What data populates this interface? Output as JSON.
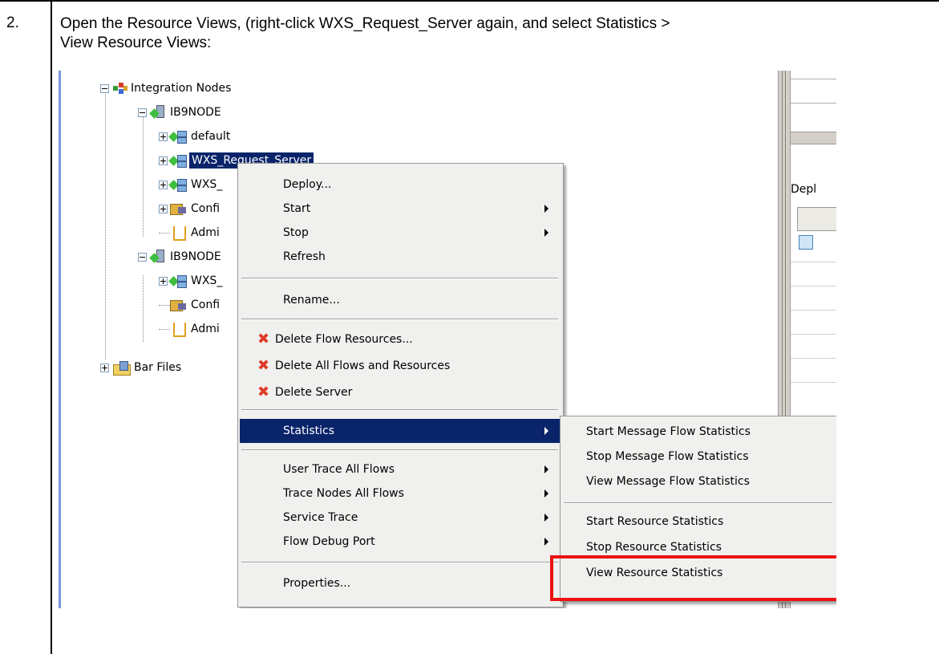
{
  "step": {
    "number": "2.",
    "instruction_line1": "Open the Resource Views, (right-click  WXS_Request_Server again, and select Statistics >",
    "instruction_line2": "View Resource Views:"
  },
  "tree": {
    "root": "Integration Nodes",
    "node1": "IB9NODE",
    "node1_children": [
      "default",
      "WXS_Request_Server",
      "WXS_",
      "Confi",
      "Admi"
    ],
    "node2": "IB9NODE",
    "node2_children": [
      "WXS_",
      "Confi",
      "Admi"
    ],
    "bar_files": "Bar Files"
  },
  "side_panel": {
    "label_fragment": "Depl"
  },
  "context_menu": {
    "items": [
      {
        "label": "Deploy...",
        "submenu": false
      },
      {
        "label": "Start",
        "submenu": true
      },
      {
        "label": "Stop",
        "submenu": true
      },
      {
        "label": "Refresh",
        "submenu": false
      },
      {
        "label": "Rename...",
        "submenu": false
      },
      {
        "label": "Delete Flow Resources...",
        "icon": "red-x-icon"
      },
      {
        "label": "Delete All Flows and Resources",
        "icon": "red-x-icon"
      },
      {
        "label": "Delete Server",
        "icon": "red-x-icon"
      },
      {
        "label": "Statistics",
        "submenu": true,
        "selected": true
      },
      {
        "label": "User Trace All Flows",
        "submenu": true
      },
      {
        "label": "Trace Nodes All Flows",
        "submenu": true
      },
      {
        "label": "Service Trace",
        "submenu": true
      },
      {
        "label": "Flow Debug Port",
        "submenu": true
      },
      {
        "label": "Properties...",
        "submenu": false
      }
    ]
  },
  "statistics_submenu": {
    "items": [
      "Start Message Flow Statistics",
      "Stop Message Flow Statistics",
      "View Message Flow Statistics",
      "Start Resource Statistics",
      "Stop Resource Statistics",
      "View Resource Statistics"
    ],
    "highlighted": "View Resource Statistics"
  },
  "colors": {
    "selection": "#0a246a",
    "menu_bg": "#f0f0ee",
    "highlight_box": "#ee1111",
    "delete_icon": "#e03b2a"
  }
}
